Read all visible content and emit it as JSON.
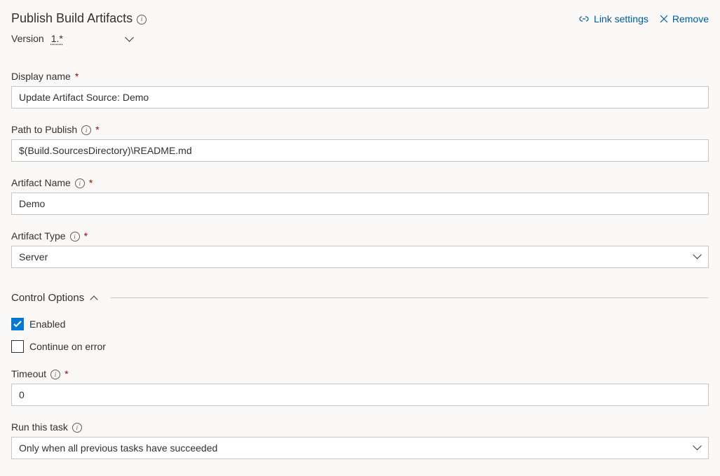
{
  "header": {
    "title": "Publish Build Artifacts",
    "link_settings": "Link settings",
    "remove": "Remove"
  },
  "version": {
    "label": "Version",
    "value": "1.*"
  },
  "fields": {
    "display_name": {
      "label": "Display name",
      "value": "Update Artifact Source: Demo"
    },
    "path_to_publish": {
      "label": "Path to Publish",
      "value": "$(Build.SourcesDirectory)\\README.md"
    },
    "artifact_name": {
      "label": "Artifact Name",
      "value": "Demo"
    },
    "artifact_type": {
      "label": "Artifact Type",
      "value": "Server"
    }
  },
  "control_options": {
    "title": "Control Options",
    "enabled_label": "Enabled",
    "enabled_checked": true,
    "continue_label": "Continue on error",
    "continue_checked": false,
    "timeout": {
      "label": "Timeout",
      "value": "0"
    },
    "run_this_task": {
      "label": "Run this task",
      "value": "Only when all previous tasks have succeeded"
    }
  }
}
